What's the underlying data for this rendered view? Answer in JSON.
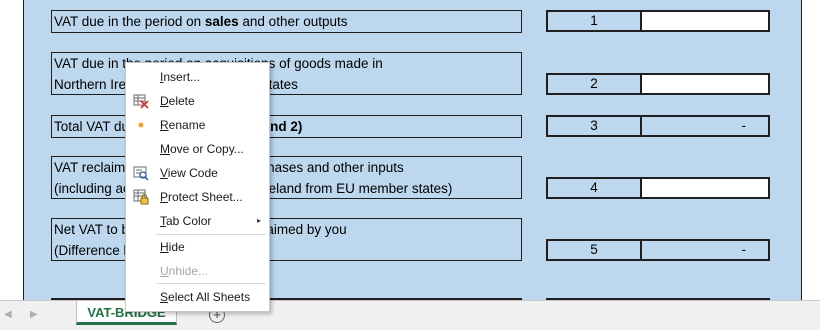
{
  "rows": [
    {
      "lines": [
        {
          "pre": "VAT due in the period on ",
          "bold": "sales",
          "post": " and other outputs"
        }
      ],
      "num": "1",
      "value": ""
    },
    {
      "lines": [
        {
          "pre": "VAT due in the period on acquisitions of goods made in",
          "bold": "",
          "post": ""
        },
        {
          "pre": "Northern Ireland from EU member states",
          "bold": "",
          "post": ""
        }
      ],
      "num": "2",
      "value": ""
    },
    {
      "lines": [
        {
          "pre": "Total VAT due (the sum of boxes ",
          "bold": "1 and 2)",
          "post": ""
        }
      ],
      "num": "3",
      "value": "-"
    },
    {
      "lines": [
        {
          "pre": "VAT reclaimed in the period on purchases and other inputs",
          "bold": "",
          "post": ""
        },
        {
          "pre": "(including acquisitions in Northern Ireland from EU member states)",
          "bold": "",
          "post": ""
        }
      ],
      "num": "4",
      "value": ""
    },
    {
      "lines": [
        {
          "pre": "Net VAT to be paid to HMRC or reclaimed by you",
          "bold": "",
          "post": ""
        },
        {
          "pre": "(Difference between boxes 3 and 4)",
          "bold": "",
          "post": ""
        }
      ],
      "num": "5",
      "value": "-"
    }
  ],
  "tabs": {
    "active": "VAT-BRIDGE",
    "add_symbol": "+",
    "nav_prev": "◀",
    "nav_next": "▶"
  },
  "context_menu": {
    "items": [
      {
        "key": "insert",
        "pre": "",
        "u": "I",
        "post": "nsert...",
        "icon": "",
        "disabled": false
      },
      {
        "key": "delete",
        "pre": "",
        "u": "D",
        "post": "elete",
        "icon": "delete-sheet-icon",
        "disabled": false
      },
      {
        "key": "rename",
        "pre": "",
        "u": "R",
        "post": "ename",
        "icon": "dot-icon",
        "disabled": false
      },
      {
        "key": "move-copy",
        "pre": "",
        "u": "M",
        "post": "ove or Copy...",
        "icon": "",
        "disabled": false
      },
      {
        "key": "view-code",
        "pre": "",
        "u": "V",
        "post": "iew Code",
        "icon": "view-code-icon",
        "disabled": false
      },
      {
        "key": "protect-sheet",
        "pre": "",
        "u": "P",
        "post": "rotect Sheet...",
        "icon": "protect-sheet-icon",
        "disabled": false
      },
      {
        "key": "tab-color",
        "pre": "",
        "u": "T",
        "post": "ab Color",
        "icon": "",
        "disabled": false,
        "submenu": "▸"
      },
      {
        "key": "hide",
        "pre": "",
        "u": "H",
        "post": "ide",
        "icon": "",
        "disabled": false
      },
      {
        "key": "unhide",
        "pre": "",
        "u": "U",
        "post": "nhide...",
        "icon": "",
        "disabled": true
      },
      {
        "key": "select-all",
        "pre": "",
        "u": "S",
        "post": "elect All Sheets",
        "icon": "",
        "disabled": false
      }
    ]
  },
  "colors": {
    "panel": "#bdd7ee",
    "tab_accent": "#217346"
  }
}
